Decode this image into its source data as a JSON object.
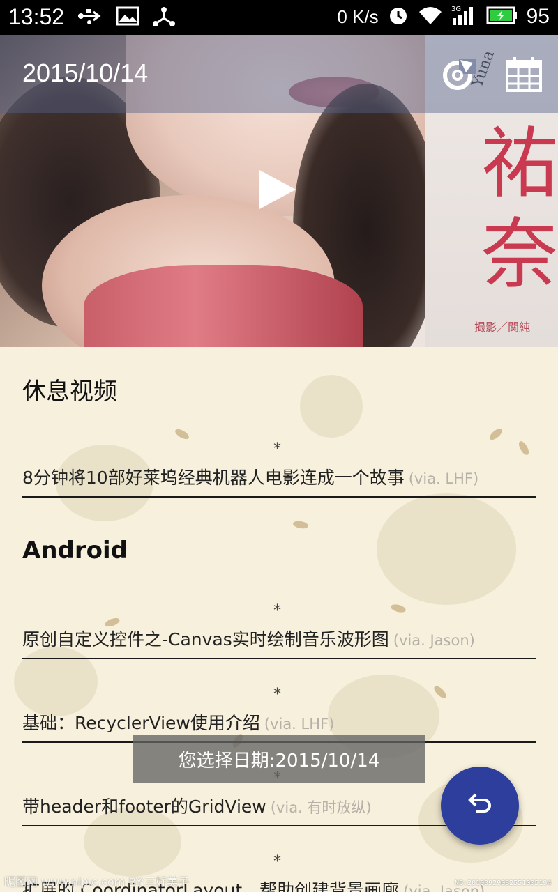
{
  "status_bar": {
    "time": "13:52",
    "net_speed": "0 K/s",
    "network": "3G",
    "battery": "95",
    "icons_left": [
      "usb-icon",
      "image-icon",
      "share-icon"
    ],
    "icons_right": [
      "alarm-icon",
      "wifi-icon",
      "signal-icon",
      "battery-icon"
    ]
  },
  "toolbar": {
    "title": "2015/10/14",
    "actions": [
      "refresh-icon",
      "calendar-icon"
    ]
  },
  "hero": {
    "poster_chars": [
      "祐",
      "奈"
    ],
    "poster_vertical": "Yuna",
    "poster_credit": "撮影／関純"
  },
  "sections": [
    {
      "title": "休息视频",
      "items": [
        {
          "title": "8分钟将10部好莱坞经典机器人电影连成一个故事",
          "via": "(via. LHF)"
        }
      ]
    },
    {
      "title": "Android",
      "items": [
        {
          "title": "原创自定义控件之-Canvas实时绘制音乐波形图",
          "via": "(via. Jason)"
        },
        {
          "title": "基础：RecyclerView使用介绍",
          "via": "(via. LHF)"
        },
        {
          "title": "带header和footer的GridView",
          "via": "(via. 有时放纵)"
        },
        {
          "title": "扩展的 CoordinatorLayout，帮助创建背景画廊",
          "via": "(via. Jason)"
        }
      ]
    }
  ],
  "toast": "您选择日期:2015/10/14",
  "watermark": {
    "left": "昵图网 www.nipic.com   BY:三好美子",
    "right": "NO:20100929082551005194"
  },
  "colors": {
    "fab": "#2d3e9d",
    "toolbar": "#55648c",
    "background": "#f6f0dc"
  }
}
